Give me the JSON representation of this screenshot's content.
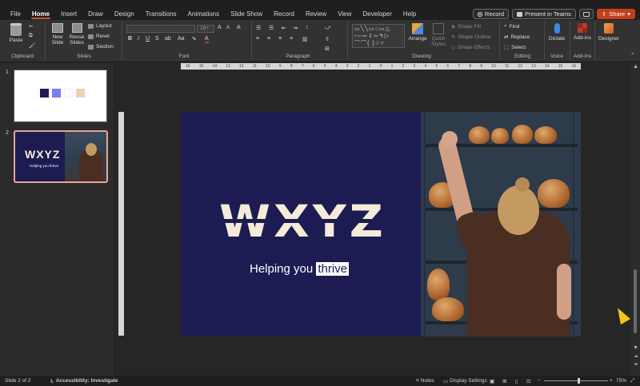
{
  "menu": {
    "tabs": [
      "File",
      "Home",
      "Insert",
      "Draw",
      "Design",
      "Transitions",
      "Animations",
      "Slide Show",
      "Record",
      "Review",
      "View",
      "Developer",
      "Help"
    ],
    "active_tab": "Home",
    "record_label": "Record",
    "present_label": "Present in Teams",
    "share_label": "Share"
  },
  "ribbon": {
    "clipboard": {
      "label": "Clipboard",
      "paste": "Paste"
    },
    "slides": {
      "label": "Slides",
      "new_slide": "New Slide",
      "reuse_slides": "Reuse Slides",
      "layout": "Layout",
      "reset": "Reset",
      "section": "Section"
    },
    "font": {
      "label": "Font",
      "font_size": "18+"
    },
    "paragraph": {
      "label": "Paragraph"
    },
    "drawing": {
      "label": "Drawing",
      "arrange": "Arrange",
      "quick_styles": "Quick Styles",
      "shape_fill": "Shape Fill",
      "shape_outline": "Shape Outline",
      "shape_effects": "Shape Effects"
    },
    "editing": {
      "label": "Editing",
      "find": "Find",
      "replace": "Replace",
      "select": "Select"
    },
    "voice": {
      "label": "Voice",
      "dictate": "Dictate"
    },
    "addins": {
      "label": "Add-ins",
      "addins": "Add-ins"
    },
    "designer": {
      "designer": "Designer"
    }
  },
  "ruler": {
    "ticks": [
      "16",
      "15",
      "14",
      "13",
      "12",
      "11",
      "10",
      "9",
      "8",
      "7",
      "6",
      "5",
      "4",
      "3",
      "2",
      "1",
      "0",
      "1",
      "2",
      "3",
      "4",
      "5",
      "6",
      "7",
      "8",
      "9",
      "10",
      "11",
      "12",
      "13",
      "14",
      "15",
      "16"
    ]
  },
  "slides_panel": {
    "slide1_number": "1",
    "slide2_number": "2",
    "thumb2_logo": "WXYZ",
    "thumb2_tagline": "Helping you thrive"
  },
  "slide": {
    "logo": "WXYZ",
    "tagline_prefix": "Helping you ",
    "tagline_highlight": "thrive",
    "background_color": "#1c1c52",
    "logo_color": "#f4ecd8",
    "swatches": [
      "#1c1c52",
      "#7b7bf2",
      "#ffffff",
      "#e8d5b5"
    ]
  },
  "status": {
    "slide_counter": "Slide 2 of 2",
    "accessibility": "Accessibility: Investigate",
    "notes": "Notes",
    "display_settings": "Display Settings",
    "zoom": "75%"
  }
}
